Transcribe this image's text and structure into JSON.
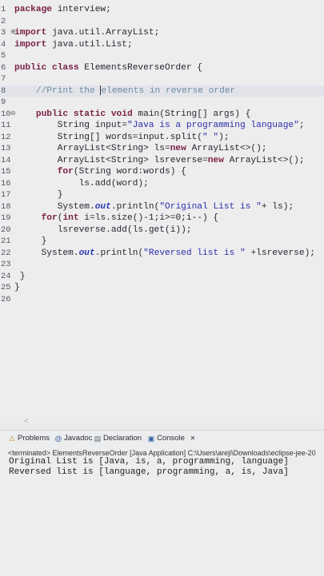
{
  "editor": {
    "lines": [
      {
        "n": "1",
        "fold": "",
        "segs": [
          {
            "t": "package",
            "c": "kw"
          },
          {
            "t": " interview;",
            "c": ""
          }
        ]
      },
      {
        "n": "2",
        "fold": "",
        "segs": []
      },
      {
        "n": "3",
        "fold": "⊕",
        "segs": [
          {
            "t": "import",
            "c": "kw"
          },
          {
            "t": " java.util.ArrayList;",
            "c": ""
          }
        ]
      },
      {
        "n": "4",
        "fold": "",
        "segs": [
          {
            "t": "import",
            "c": "kw"
          },
          {
            "t": " java.util.List;",
            "c": ""
          }
        ]
      },
      {
        "n": "5",
        "fold": "",
        "segs": []
      },
      {
        "n": "6",
        "fold": "",
        "segs": [
          {
            "t": "public class",
            "c": "kw"
          },
          {
            "t": " ElementsReverseOrder {",
            "c": ""
          }
        ]
      },
      {
        "n": "7",
        "fold": "",
        "segs": []
      },
      {
        "n": "8",
        "fold": "",
        "segs": [
          {
            "t": "    //Print the ",
            "c": "cm"
          },
          {
            "t": "elements in reverse order",
            "c": "cm"
          }
        ]
      },
      {
        "n": "9",
        "fold": "",
        "segs": []
      },
      {
        "n": "10",
        "fold": "⊖",
        "segs": [
          {
            "t": "    public static void",
            "c": "kw"
          },
          {
            "t": " main(String[] args) {",
            "c": ""
          }
        ]
      },
      {
        "n": "11",
        "fold": "",
        "segs": [
          {
            "t": "        String input=",
            "c": ""
          },
          {
            "t": "\"Java is a programming language\"",
            "c": "str"
          },
          {
            "t": ";",
            "c": ""
          }
        ]
      },
      {
        "n": "12",
        "fold": "",
        "segs": [
          {
            "t": "        String[] words=input.split(",
            "c": ""
          },
          {
            "t": "\" \"",
            "c": "str"
          },
          {
            "t": ");",
            "c": ""
          }
        ]
      },
      {
        "n": "13",
        "fold": "",
        "segs": [
          {
            "t": "        ArrayList<String> ls=",
            "c": ""
          },
          {
            "t": "new",
            "c": "kw"
          },
          {
            "t": " ArrayList<>();",
            "c": ""
          }
        ]
      },
      {
        "n": "14",
        "fold": "",
        "segs": [
          {
            "t": "        ArrayList<String> lsreverse=",
            "c": ""
          },
          {
            "t": "new",
            "c": "kw"
          },
          {
            "t": " ArrayList<>();",
            "c": ""
          }
        ]
      },
      {
        "n": "15",
        "fold": "",
        "segs": [
          {
            "t": "        for",
            "c": "kw"
          },
          {
            "t": "(String word:words) {",
            "c": ""
          }
        ]
      },
      {
        "n": "16",
        "fold": "",
        "segs": [
          {
            "t": "            ls.add(word);",
            "c": ""
          }
        ]
      },
      {
        "n": "17",
        "fold": "",
        "segs": [
          {
            "t": "        }",
            "c": ""
          }
        ]
      },
      {
        "n": "18",
        "fold": "",
        "segs": [
          {
            "t": "        System.",
            "c": ""
          },
          {
            "t": "out",
            "c": "fld"
          },
          {
            "t": ".println(",
            "c": ""
          },
          {
            "t": "\"Original List is \"",
            "c": "str"
          },
          {
            "t": "+ ls);",
            "c": ""
          }
        ]
      },
      {
        "n": "19",
        "fold": "",
        "segs": [
          {
            "t": "     for",
            "c": "kw"
          },
          {
            "t": "(",
            "c": ""
          },
          {
            "t": "int",
            "c": "kw"
          },
          {
            "t": " i=ls.size()-1;i>=0;i--) {",
            "c": ""
          }
        ]
      },
      {
        "n": "20",
        "fold": "",
        "segs": [
          {
            "t": "        lsreverse.add(ls.get(i));",
            "c": ""
          }
        ]
      },
      {
        "n": "21",
        "fold": "",
        "segs": [
          {
            "t": "     }",
            "c": ""
          }
        ]
      },
      {
        "n": "22",
        "fold": "",
        "segs": [
          {
            "t": "     System.",
            "c": ""
          },
          {
            "t": "out",
            "c": "fld"
          },
          {
            "t": ".println(",
            "c": ""
          },
          {
            "t": "\"Reversed list is \"",
            "c": "str"
          },
          {
            "t": " +lsreverse);",
            "c": ""
          }
        ]
      },
      {
        "n": "23",
        "fold": "",
        "segs": []
      },
      {
        "n": "24",
        "fold": "",
        "segs": [
          {
            "t": " }",
            "c": ""
          }
        ]
      },
      {
        "n": "25",
        "fold": "",
        "segs": [
          {
            "t": "}",
            "c": ""
          }
        ]
      },
      {
        "n": "26",
        "fold": "",
        "segs": []
      }
    ],
    "scroll_glyph": "<"
  },
  "console": {
    "tabs": [
      {
        "label": "Problems",
        "icon": "problems-icon",
        "glyph": "⚠"
      },
      {
        "label": "Javadoc",
        "icon": "javadoc-icon",
        "glyph": "@"
      },
      {
        "label": "Declaration",
        "icon": "declaration-icon",
        "glyph": "▤"
      },
      {
        "label": "Console",
        "icon": "console-icon",
        "glyph": "▣"
      }
    ],
    "close_glyph": "✕",
    "terminated": "<terminated> ElementsReverseOrder [Java Application] C:\\Users\\areji\\Downloads\\eclipse-jee-20",
    "output": [
      "Original List is [Java, is, a, programming, language]",
      "Reversed list is [language, programming, a, is, Java]"
    ]
  },
  "colors": {
    "keyword": "#7a1f45",
    "string": "#2a2fa8",
    "comment": "#6e8aa0",
    "field": "#2a3ab0",
    "background": "#ededee"
  }
}
